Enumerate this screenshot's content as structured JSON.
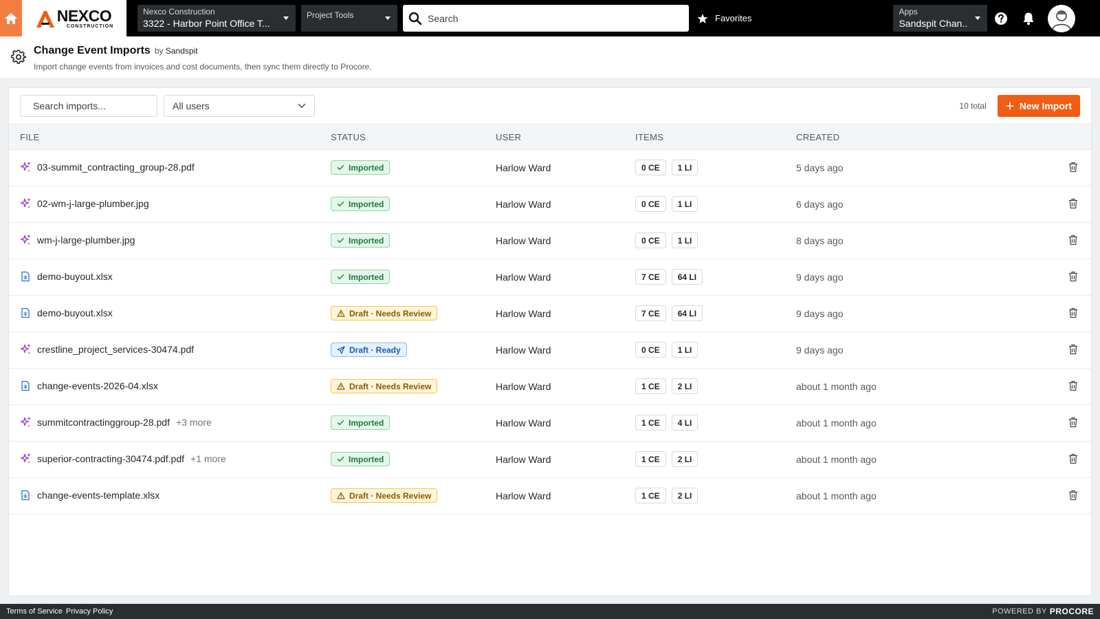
{
  "nav": {
    "company": "NEXCO",
    "company_sub": "CONSTRUCTION",
    "project_label": "Nexco Construction",
    "project_value": "3322 - Harbor Point Office T...",
    "tools_label": "Project Tools",
    "search_placeholder": "Search",
    "favorites": "Favorites",
    "apps_label": "Apps",
    "apps_value": "Sandspit Chan..."
  },
  "header": {
    "title": "Change Event Imports",
    "by": "by",
    "vendor": "Sandspit",
    "description": "Import change events from invoices and cost documents, then sync them directly to Procore."
  },
  "toolbar": {
    "search_placeholder": "Search imports...",
    "users_filter": "All users",
    "total": "10 total",
    "new_import": "New Import"
  },
  "columns": {
    "file": "FILE",
    "status": "STATUS",
    "user": "USER",
    "items": "ITEMS",
    "created": "CREATED"
  },
  "rows": [
    {
      "file": "03-summit_contracting_group-28.pdf",
      "more": "",
      "icon": "sparkle-icon",
      "status": "Imported",
      "status_type": "ok",
      "user": "Harlow Ward",
      "ce": "0 CE",
      "li": "1 LI",
      "created": "5 days ago"
    },
    {
      "file": "02-wm-j-large-plumber.jpg",
      "more": "",
      "icon": "sparkle-icon",
      "status": "Imported",
      "status_type": "ok",
      "user": "Harlow Ward",
      "ce": "0 CE",
      "li": "1 LI",
      "created": "6 days ago"
    },
    {
      "file": "wm-j-large-plumber.jpg",
      "more": "",
      "icon": "sparkle-icon",
      "status": "Imported",
      "status_type": "ok",
      "user": "Harlow Ward",
      "ce": "0 CE",
      "li": "1 LI",
      "created": "8 days ago"
    },
    {
      "file": "demo-buyout.xlsx",
      "more": "",
      "icon": "spreadsheet-icon",
      "status": "Imported",
      "status_type": "ok",
      "user": "Harlow Ward",
      "ce": "7 CE",
      "li": "64 LI",
      "created": "9 days ago"
    },
    {
      "file": "demo-buyout.xlsx",
      "more": "",
      "icon": "spreadsheet-icon",
      "status": "Draft · Needs Review",
      "status_type": "warn",
      "user": "Harlow Ward",
      "ce": "7 CE",
      "li": "64 LI",
      "created": "9 days ago"
    },
    {
      "file": "crestline_project_services-30474.pdf",
      "more": "",
      "icon": "sparkle-icon",
      "status": "Draft · Ready",
      "status_type": "ready",
      "user": "Harlow Ward",
      "ce": "0 CE",
      "li": "1 LI",
      "created": "9 days ago"
    },
    {
      "file": "change-events-2026-04.xlsx",
      "more": "",
      "icon": "spreadsheet-icon",
      "status": "Draft · Needs Review",
      "status_type": "warn",
      "user": "Harlow Ward",
      "ce": "1 CE",
      "li": "2 LI",
      "created": "about 1 month ago"
    },
    {
      "file": "summitcontractinggroup-28.pdf",
      "more": "+3 more",
      "icon": "sparkle-icon",
      "status": "Imported",
      "status_type": "ok",
      "user": "Harlow Ward",
      "ce": "1 CE",
      "li": "4 LI",
      "created": "about 1 month ago"
    },
    {
      "file": "superior-contracting-30474.pdf.pdf",
      "more": "+1 more",
      "icon": "sparkle-icon",
      "status": "Imported",
      "status_type": "ok",
      "user": "Harlow Ward",
      "ce": "1 CE",
      "li": "2 LI",
      "created": "about 1 month ago"
    },
    {
      "file": "change-events-template.xlsx",
      "more": "",
      "icon": "spreadsheet-icon",
      "status": "Draft · Needs Review",
      "status_type": "warn",
      "user": "Harlow Ward",
      "ce": "1 CE",
      "li": "2 LI",
      "created": "about 1 month ago"
    }
  ],
  "footer": {
    "terms": "Terms of Service",
    "privacy": "Privacy Policy",
    "powered_by": "POWERED BY",
    "brand": "PROCORE"
  },
  "colors": {
    "accent": "#f05d13",
    "home": "#f47e42",
    "nav_bg": "#000000",
    "sparkle": "#9b3fd1",
    "spreadsheet": "#2f6fd6"
  }
}
